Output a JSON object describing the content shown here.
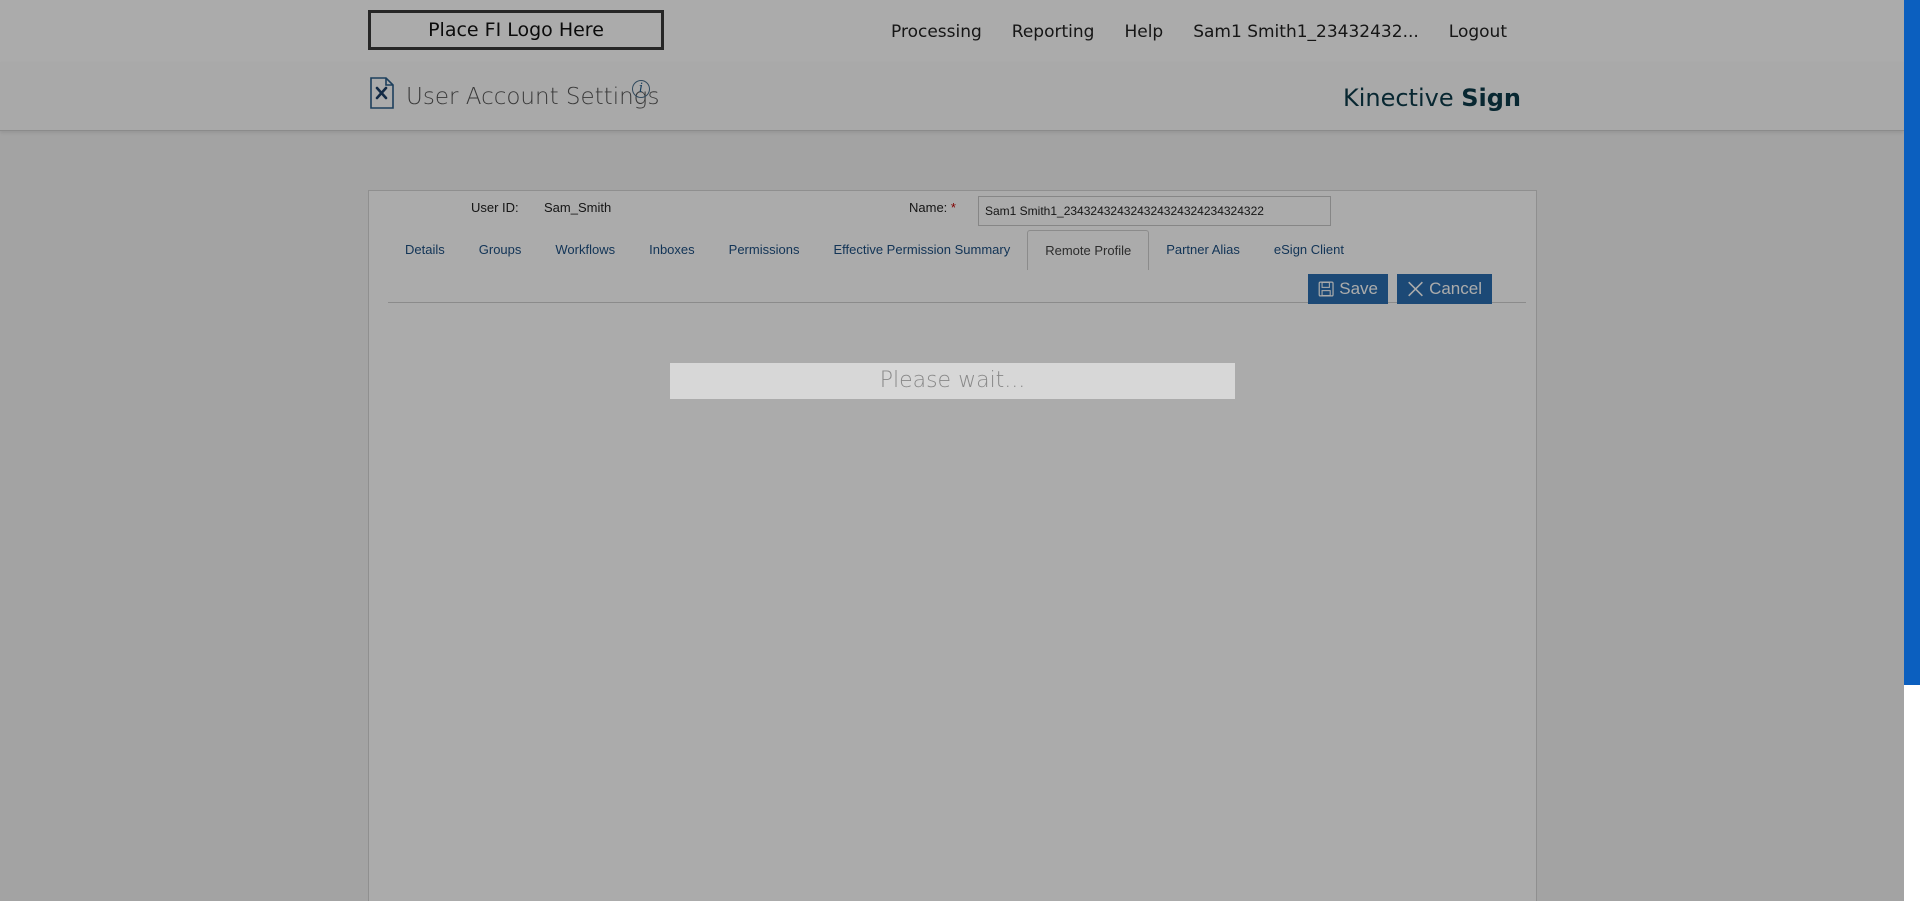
{
  "topnav": {
    "logo_text": "Place FI Logo Here",
    "items": [
      "Processing",
      "Reporting",
      "Help",
      "Sam1 Smith1_23432432...",
      "Logout"
    ]
  },
  "header": {
    "title": "User Account Settings",
    "info_glyph": "i",
    "brand_regular": "Kinective ",
    "brand_bold": "Sign"
  },
  "form": {
    "user_id_label": "User ID:",
    "user_id_value": "Sam_Smith",
    "name_label": "Name:",
    "required_mark": "*",
    "name_value": "Sam1 Smith1_234324324324324324324234324322"
  },
  "tabs": [
    {
      "label": "Details",
      "active": false
    },
    {
      "label": "Groups",
      "active": false
    },
    {
      "label": "Workflows",
      "active": false
    },
    {
      "label": "Inboxes",
      "active": false
    },
    {
      "label": "Permissions",
      "active": false
    },
    {
      "label": "Effective Permission Summary",
      "active": false
    },
    {
      "label": "Remote Profile",
      "active": true
    },
    {
      "label": "Partner Alias",
      "active": false
    },
    {
      "label": "eSign Client",
      "active": false
    }
  ],
  "actions": {
    "save_label": "Save",
    "cancel_label": "Cancel"
  },
  "loading": {
    "message": "Please wait..."
  },
  "icons": {
    "page": "document-settings-icon",
    "info": "info-icon",
    "save": "floppy-disk-icon",
    "cancel": "close-icon"
  },
  "colors": {
    "accent": "#2a6eb0",
    "link": "#1d4f82",
    "brand": "#0c3b4a",
    "scrollbar": "#0b5fbf"
  }
}
